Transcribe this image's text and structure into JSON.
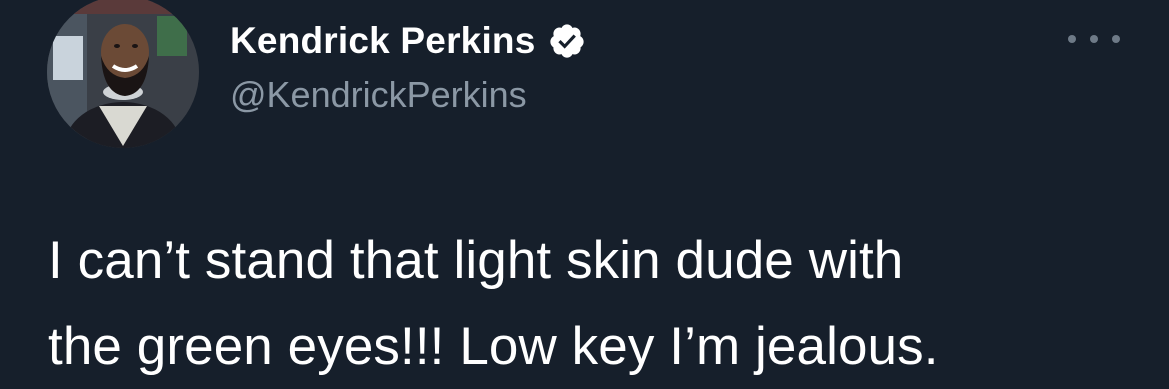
{
  "author": {
    "display_name": "Kendrick Perkins",
    "handle": "@KendrickPerkins",
    "verified": true,
    "avatar_icon": "cartoon-portrait-avatar"
  },
  "more_icon": "ellipsis-icon",
  "tweet": {
    "lines": [
      "I can’t stand that light skin dude with",
      "the green eyes!!! Low key I’m jealous."
    ]
  },
  "colors": {
    "background": "#161f2b",
    "primary_text": "#ffffff",
    "secondary_text": "#8b98a5",
    "verified_badge": "#ffffff"
  }
}
